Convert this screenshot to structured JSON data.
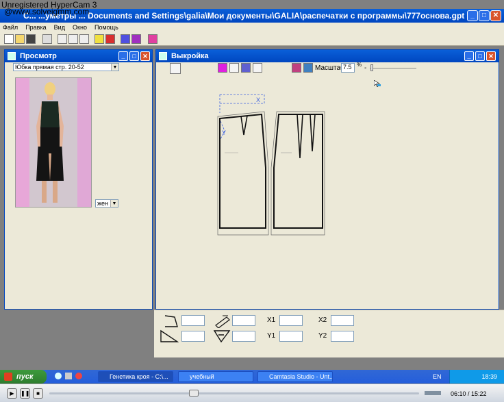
{
  "watermark": {
    "line1": "Unregistered HyperCam 3",
    "line2": "@www.solveigmm.com"
  },
  "main_window": {
    "title": "С... ...уметры ... Documents and Settings\\galia\\Мои документы\\GALIA\\распечатки с программы\\777основа.gpt",
    "minimize": "_",
    "maximize": "□",
    "close": "✕"
  },
  "menu": [
    "Файл",
    "Правка",
    "Вид",
    "Окно",
    "Помощь"
  ],
  "preview_window": {
    "title": "Просмотр",
    "model_select": "Юбка прямая стр. 20-52",
    "gender_select": "жен"
  },
  "pattern_window": {
    "title": "Выкройка",
    "scale_label": "Масштаб",
    "scale_value": "7.5",
    "scale_unit": "%",
    "scale_minus": "-"
  },
  "bottom_panel": {
    "labels": [
      "X1",
      "X2",
      "Y1",
      "Y2"
    ]
  },
  "taskbar": {
    "start": "пуск",
    "tasks": [
      "Генетика кроя - С:\\...",
      "учебный",
      "Camtasia Studio - Unt..."
    ],
    "lang": "EN",
    "time": "18:39"
  },
  "player": {
    "time": "06:10 / 15:22"
  },
  "colors": {
    "titlebar": "#0a5fd8",
    "window_bg": "#ece9d8",
    "mdi_bg": "#808080",
    "pattern_line": "#111111",
    "guide_line": "#3a5fe0"
  }
}
